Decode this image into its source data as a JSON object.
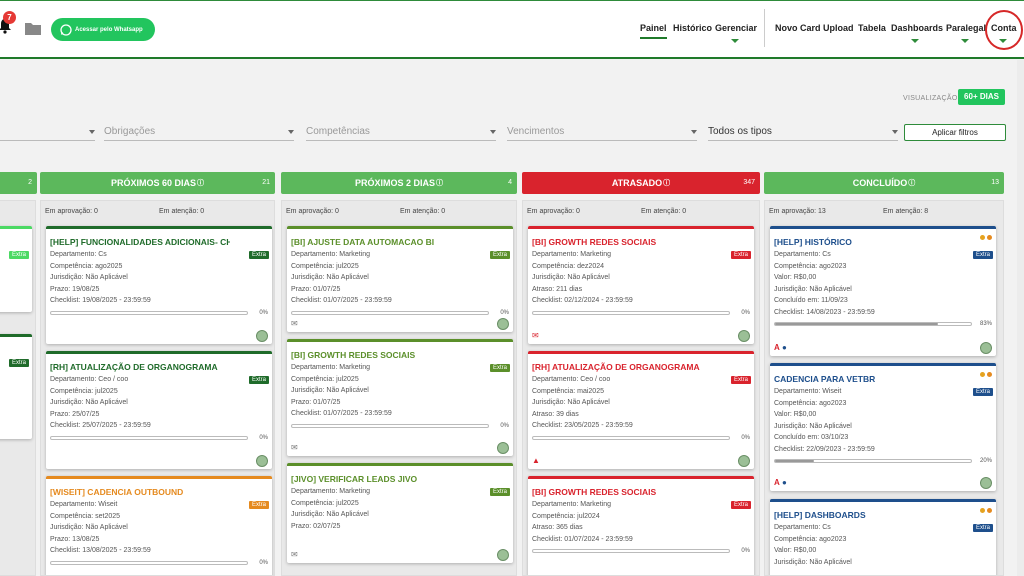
{
  "header": {
    "notifications_count": "7",
    "whatsapp_label": "Acessar pelo Whatsapp",
    "nav": [
      "Painel",
      "Histórico",
      "Gerenciar",
      "Novo Card",
      "Upload",
      "Tabela",
      "Dashboards",
      "Paralegal",
      "Conta"
    ]
  },
  "view": {
    "label": "VISUALIZAÇÃO",
    "value": "60+ DIAS"
  },
  "filters": {
    "obligations": "Obrigações",
    "competences": "Competências",
    "deadlines": "Vencimentos",
    "types": "Todos os tipos",
    "apply": "Aplicar filtros"
  },
  "colors": {
    "green_header": "#5cb85c",
    "red_header": "#d9232d",
    "dark_green": "#1f6b2a",
    "orange": "#e58a1f",
    "blue": "#1e4f8c"
  },
  "columns": [
    {
      "title": "",
      "count": "2",
      "approval": "",
      "attention": ""
    },
    {
      "title": "PRÓXIMOS 60 DIAS",
      "count": "21",
      "approval": "Em aprovação: 0",
      "attention": "Em atenção: 0",
      "cards": [
        {
          "title": "[HELP] FUNCIONALIDADES ADICIONAIS- CH",
          "tag": "Extra",
          "lines": [
            "Departamento: Cs",
            "Competência: ago2025",
            "Jurisdição: Não Aplicável",
            "Prazo: 19/08/25",
            "Checklist: 19/08/2025 - 23:59:59"
          ],
          "pct": "0%"
        },
        {
          "title": "[RH] ATUALIZAÇÃO DE ORGANOGRAMA",
          "tag": "Extra",
          "lines": [
            "Departamento: Ceo / coo",
            "Competência: jul2025",
            "Jurisdição: Não Aplicável",
            "Prazo: 25/07/25",
            "Checklist: 25/07/2025 - 23:59:59"
          ],
          "pct": "0%"
        },
        {
          "title": "[WISEIT] CADENCIA OUTBOUND",
          "tag": "Extra",
          "lines": [
            "Departamento: Wiseit",
            "Competência: set2025",
            "Jurisdição: Não Aplicável",
            "Prazo: 13/08/25",
            "Checklist: 13/08/2025 - 23:59:59"
          ],
          "pct": "0%"
        }
      ]
    },
    {
      "title": "PRÓXIMOS 2 DIAS",
      "count": "4",
      "approval": "Em aprovação: 0",
      "attention": "Em atenção: 0",
      "cards": [
        {
          "title": "[BI] AJUSTE DATA AUTOMACAO BI",
          "tag": "Extra",
          "lines": [
            "Departamento: Marketing",
            "Competência: jul2025",
            "Jurisdição: Não Aplicável",
            "Prazo: 01/07/25",
            "Checklist: 01/07/2025 - 23:59:59"
          ],
          "pct": "0%"
        },
        {
          "title": "[BI] GROWTH REDES SOCIAIS",
          "tag": "Extra",
          "lines": [
            "Departamento: Marketing",
            "Competência: jul2025",
            "Jurisdição: Não Aplicável",
            "Prazo: 01/07/25",
            "Checklist: 01/07/2025 - 23:59:59"
          ],
          "pct": "0%"
        },
        {
          "title": "[JIVO] VERIFICAR LEADS JIVO",
          "tag": "Extra",
          "lines": [
            "Departamento: Marketing",
            "Competência: jul2025",
            "Jurisdição: Não Aplicável",
            "Prazo: 02/07/25"
          ],
          "pct": ""
        }
      ]
    },
    {
      "title": "ATRASADO",
      "count": "347",
      "approval": "Em aprovação: 0",
      "attention": "Em atenção: 0",
      "cards": [
        {
          "title": "[BI] GROWTH REDES SOCIAIS",
          "tag": "Extra",
          "lines": [
            "Departamento: Marketing",
            "Competência: dez2024",
            "Jurisdição: Não Aplicável",
            "Atraso: 211 dias",
            "Checklist: 02/12/2024 - 23:59:59"
          ],
          "pct": "0%"
        },
        {
          "title": "[RH] ATUALIZAÇÃO DE ORGANOGRAMA",
          "tag": "Extra",
          "lines": [
            "Departamento: Ceo / coo",
            "Competência: mai2025",
            "Jurisdição: Não Aplicável",
            "Atraso: 39 dias",
            "Checklist: 23/05/2025 - 23:59:59"
          ],
          "pct": "0%"
        },
        {
          "title": "[BI] GROWTH REDES SOCIAIS",
          "tag": "Extra",
          "lines": [
            "Departamento: Marketing",
            "Competência: jul2024",
            "Atraso: 365 dias",
            "Checklist: 01/07/2024 - 23:59:59"
          ],
          "pct": "0%"
        }
      ]
    },
    {
      "title": "CONCLUÍDO",
      "count": "13",
      "approval": "Em aprovação: 13",
      "attention": "Em atenção: 8",
      "cards": [
        {
          "title": "[HELP] HISTÓRICO",
          "tag": "Extra",
          "lines": [
            "Departamento: Cs",
            "Competência: ago2023",
            "Valor: R$0,00",
            "Jurisdição: Não Aplicável",
            "Concluído em: 11/09/23",
            "Checklist: 14/08/2023 - 23:59:59"
          ],
          "pct": "83%",
          "progress": 0.83
        },
        {
          "title": "CADENCIA PARA VETBR",
          "tag": "Extra",
          "lines": [
            "Departamento: Wiseit",
            "Competência: ago2023",
            "Valor: R$0,00",
            "Jurisdição: Não Aplicável",
            "Concluído em: 03/10/23",
            "Checklist: 22/09/2023 - 23:59:59"
          ],
          "pct": "20%",
          "progress": 0.2
        },
        {
          "title": "[HELP] DASHBOARDS",
          "tag": "Extra",
          "lines": [
            "Departamento: Cs",
            "Competência: ago2023",
            "Valor: R$0,00",
            "Jurisdição: Não Aplicável"
          ],
          "pct": ""
        }
      ]
    }
  ]
}
